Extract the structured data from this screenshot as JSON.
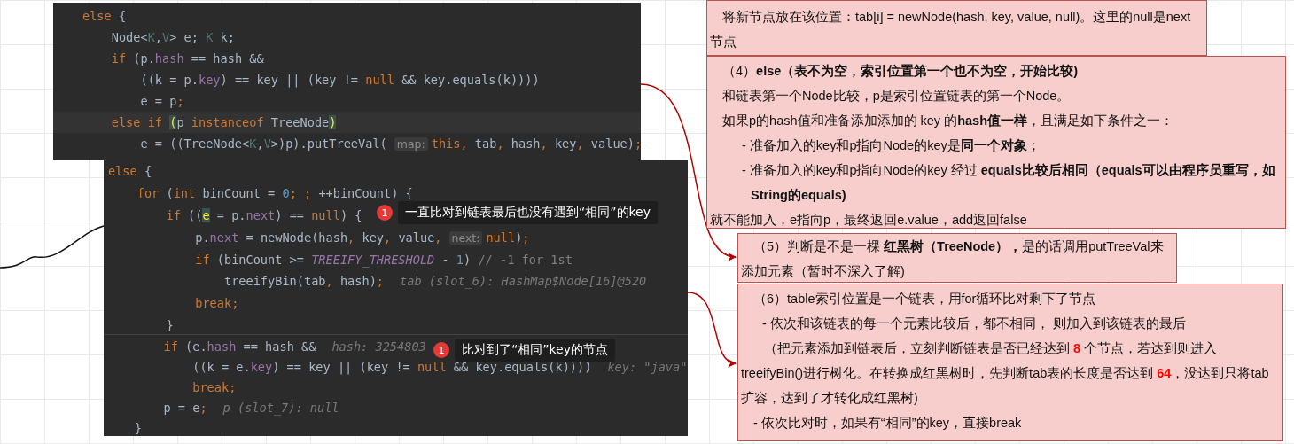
{
  "code_panels": [
    {
      "lines": [
        {
          "highlighted": false,
          "tokens": [
            {
              "text": "else",
              "kind": "kw"
            },
            {
              "text": " {",
              "kind": "txt"
            }
          ]
        },
        {
          "highlighted": false,
          "tokens": [
            {
              "text": "    Node<",
              "kind": "txt"
            },
            {
              "text": "K",
              "kind": "type"
            },
            {
              "text": ",",
              "kind": "txt"
            },
            {
              "text": "V",
              "kind": "type"
            },
            {
              "text": "> e; ",
              "kind": "txt"
            },
            {
              "text": "K",
              "kind": "type"
            },
            {
              "text": " k;",
              "kind": "txt"
            }
          ]
        },
        {
          "highlighted": false,
          "tokens": [
            {
              "text": "    if",
              "kind": "kw"
            },
            {
              "text": " (p.",
              "kind": "txt"
            },
            {
              "text": "hash",
              "kind": "field"
            },
            {
              "text": " == hash &&",
              "kind": "txt"
            }
          ]
        },
        {
          "highlighted": false,
          "tokens": [
            {
              "text": "        ((k = p.",
              "kind": "txt"
            },
            {
              "text": "key",
              "kind": "field"
            },
            {
              "text": ") == key || (key != ",
              "kind": "txt"
            },
            {
              "text": "null",
              "kind": "kw"
            },
            {
              "text": " && key.equals(k))))",
              "kind": "txt"
            }
          ]
        },
        {
          "highlighted": false,
          "tokens": [
            {
              "text": "        e = p",
              "kind": "txt"
            },
            {
              "text": ";",
              "kind": "kw"
            }
          ]
        },
        {
          "highlighted": true,
          "tokens": [
            {
              "text": "    else if ",
              "kind": "kw"
            },
            {
              "text": "(",
              "kind": "match"
            },
            {
              "text": "p ",
              "kind": "txt"
            },
            {
              "text": "instanceof",
              "kind": "kw"
            },
            {
              "text": " TreeNode",
              "kind": "txt"
            },
            {
              "text": ")",
              "kind": "match"
            }
          ]
        },
        {
          "highlighted": false,
          "tokens": [
            {
              "text": "        e = ((TreeNode<",
              "kind": "txt"
            },
            {
              "text": "K",
              "kind": "type"
            },
            {
              "text": ",",
              "kind": "txt"
            },
            {
              "text": "V",
              "kind": "type"
            },
            {
              "text": ">)p).putTreeVal(",
              "kind": "txt"
            },
            {
              "text": "map:",
              "kind": "hint"
            },
            {
              "text": "this,",
              "kind": "kw"
            },
            {
              "text": " tab",
              "kind": "txt"
            },
            {
              "text": ",",
              "kind": "kw"
            },
            {
              "text": " hash",
              "kind": "txt"
            },
            {
              "text": ",",
              "kind": "kw"
            },
            {
              "text": " key",
              "kind": "txt"
            },
            {
              "text": ",",
              "kind": "kw"
            },
            {
              "text": " value)",
              "kind": "txt"
            },
            {
              "text": ";",
              "kind": "kw"
            }
          ]
        }
      ]
    },
    {
      "lines": [
        {
          "highlighted": false,
          "tokens": [
            {
              "text": "else",
              "kind": "kw"
            },
            {
              "text": " {",
              "kind": "txt"
            }
          ]
        },
        {
          "highlighted": false,
          "tokens": [
            {
              "text": "    for",
              "kind": "kw"
            },
            {
              "text": " (",
              "kind": "txt"
            },
            {
              "text": "int",
              "kind": "kw"
            },
            {
              "text": " binCount = ",
              "kind": "txt"
            },
            {
              "text": "0",
              "kind": "num"
            },
            {
              "text": "; ;",
              "kind": "kw"
            },
            {
              "text": " ++binCount) {",
              "kind": "txt"
            }
          ]
        },
        {
          "highlighted": false,
          "tokens": [
            {
              "text": "        if",
              "kind": "kw"
            },
            {
              "text": " ((",
              "kind": "txt"
            },
            {
              "text": "e",
              "kind": "match"
            },
            {
              "text": " = p.",
              "kind": "txt"
            },
            {
              "text": "next",
              "kind": "field"
            },
            {
              "text": ") == ",
              "kind": "txt"
            },
            {
              "text": "null",
              "kind": "kw"
            },
            {
              "text": ") {",
              "kind": "txt"
            }
          ]
        },
        {
          "highlighted": false,
          "tokens": [
            {
              "text": "            p.",
              "kind": "txt"
            },
            {
              "text": "next",
              "kind": "field"
            },
            {
              "text": " = newNode(hash",
              "kind": "txt"
            },
            {
              "text": ",",
              "kind": "kw"
            },
            {
              "text": " key",
              "kind": "txt"
            },
            {
              "text": ",",
              "kind": "kw"
            },
            {
              "text": " value",
              "kind": "txt"
            },
            {
              "text": ",",
              "kind": "kw"
            },
            {
              "text": "next:",
              "kind": "hint"
            },
            {
              "text": "null",
              "kind": "kw"
            },
            {
              "text": ")",
              "kind": "txt"
            },
            {
              "text": ";",
              "kind": "kw"
            }
          ]
        },
        {
          "highlighted": false,
          "tokens": [
            {
              "text": "            if",
              "kind": "kw"
            },
            {
              "text": " (binCount >= ",
              "kind": "txt"
            },
            {
              "text": "TREEIFY_THRESHOLD",
              "kind": "const"
            },
            {
              "text": " - ",
              "kind": "txt"
            },
            {
              "text": "1",
              "kind": "num"
            },
            {
              "text": ") ",
              "kind": "txt"
            },
            {
              "text": "// -1 for 1st",
              "kind": "comment"
            }
          ]
        },
        {
          "highlighted": false,
          "tokens": [
            {
              "text": "                treeifyBin(tab",
              "kind": "txt"
            },
            {
              "text": ",",
              "kind": "kw"
            },
            {
              "text": " hash)",
              "kind": "txt"
            },
            {
              "text": ";",
              "kind": "kw"
            }
          ],
          "debug": "tab (slot_6): HashMap$Node[16]@520"
        },
        {
          "highlighted": false,
          "tokens": [
            {
              "text": "            break;",
              "kind": "kw"
            }
          ]
        },
        {
          "highlighted": false,
          "tokens": [
            {
              "text": "        }",
              "kind": "txt"
            }
          ]
        }
      ],
      "callout": {
        "badge": "1",
        "text": "一直比对到链表最后也没有遇到“相同”的key"
      }
    },
    {
      "lines": [
        {
          "highlighted": false,
          "tokens": [
            {
              "text": "        if",
              "kind": "kw"
            },
            {
              "text": " (e.",
              "kind": "txt"
            },
            {
              "text": "hash",
              "kind": "field"
            },
            {
              "text": " == hash &&",
              "kind": "txt"
            }
          ],
          "debug": "hash: 3254803"
        },
        {
          "highlighted": false,
          "tokens": [
            {
              "text": "            ((k = e.",
              "kind": "txt"
            },
            {
              "text": "key",
              "kind": "field"
            },
            {
              "text": ") == key || (key != ",
              "kind": "txt"
            },
            {
              "text": "null",
              "kind": "kw"
            },
            {
              "text": " && key.equals(k))))",
              "kind": "txt"
            }
          ],
          "debug": "key: \"java\""
        },
        {
          "highlighted": false,
          "tokens": [
            {
              "text": "            break;",
              "kind": "kw"
            }
          ]
        },
        {
          "highlighted": false,
          "tokens": [
            {
              "text": "        p = e",
              "kind": "txt"
            },
            {
              "text": ";",
              "kind": "kw"
            }
          ],
          "debug": "p (slot_7): null"
        },
        {
          "highlighted": false,
          "tokens": [
            {
              "text": "    }",
              "kind": "txt"
            }
          ]
        }
      ],
      "callout": {
        "badge": "1",
        "text": "比对到了“相同”key的节点"
      }
    }
  ],
  "notes": [
    {
      "paragraphs": [
        {
          "kind": "lead",
          "segments": [
            {
              "text": "将新节点放在该位置：tab[i] = newNode(hash, key, value, null)。这里的null是next节点",
              "kind": "n"
            }
          ]
        }
      ]
    },
    {
      "paragraphs": [
        {
          "kind": "indent",
          "segments": [
            {
              "text": "（4）",
              "kind": "n"
            },
            {
              "text": "else（表不为空，索引位置第一个也不为空，开始比较)",
              "kind": "b"
            }
          ]
        },
        {
          "kind": "indent",
          "segments": [
            {
              "text": "和链表第一个Node比较，p是索引位置链表的第一个Node。",
              "kind": "n"
            }
          ]
        },
        {
          "kind": "indent",
          "segments": [
            {
              "text": "如果p的hash值和准备添加添加的 key 的",
              "kind": "n"
            },
            {
              "text": "hash值一样",
              "kind": "b"
            },
            {
              "text": "，且满足如下条件之一：",
              "kind": "n"
            }
          ]
        },
        {
          "kind": "bullet",
          "segments": [
            {
              "text": "- 准备加入的key和p指向Node的key是",
              "kind": "n"
            },
            {
              "text": "同一个对象",
              "kind": "b"
            },
            {
              "text": "；",
              "kind": "n"
            }
          ]
        },
        {
          "kind": "bullet",
          "segments": [
            {
              "text": "- 准备加入的key和p指向Node的key 经过 ",
              "kind": "n"
            },
            {
              "text": "equals比较后相同（equals可以由程序员重写，如String的equals)",
              "kind": "b"
            }
          ]
        },
        {
          "kind": "flush",
          "segments": [
            {
              "text": "就不能加入，e指向p，最终返回e.value，add返回false",
              "kind": "n"
            }
          ]
        }
      ]
    },
    {
      "paragraphs": [
        {
          "kind": "lead",
          "segments": [
            {
              "text": "（5）判断是不是一棵 ",
              "kind": "n"
            },
            {
              "text": "红黑树（TreeNode），",
              "kind": "b"
            },
            {
              "text": "是的话调用putTreeVal来添加元素（暂时不深入了解)",
              "kind": "n"
            }
          ]
        }
      ]
    },
    {
      "paragraphs": [
        {
          "kind": "indent",
          "segments": [
            {
              "text": "（6）table索引位置是一个链表，用for循环比对剩下了节点",
              "kind": "n"
            }
          ]
        },
        {
          "kind": "sub",
          "segments": [
            {
              "text": "- 依次和该链表的每一个元素比较后，都不相同， 则加入到该链表的最后",
              "kind": "n"
            }
          ]
        },
        {
          "kind": "wide-lead",
          "segments": [
            {
              "text": "（把元素添加到链表后，立刻判断链表是否已经达到 ",
              "kind": "n"
            },
            {
              "text": "8",
              "kind": "r"
            },
            {
              "text": " 个节点，若达到则进入treeifyBin()进行树化。在转换成红黑树时，先判断tab表的长度是否达到 ",
              "kind": "n"
            },
            {
              "text": "64",
              "kind": "r"
            },
            {
              "text": "，没达到只将tab扩容，达到了才转化成红黑树)",
              "kind": "n"
            }
          ]
        },
        {
          "kind": "indent",
          "segments": [
            {
              "text": "- 依次比对时，如果有“相同”的key，直接break",
              "kind": "n"
            }
          ]
        }
      ]
    }
  ]
}
